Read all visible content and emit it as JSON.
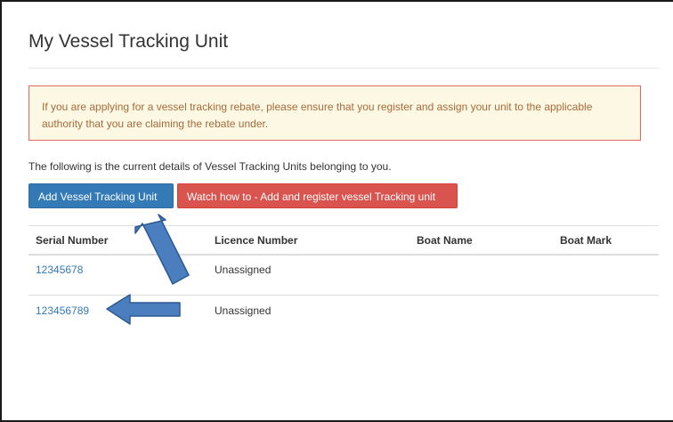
{
  "page": {
    "title": "My Vessel Tracking Unit"
  },
  "alert": {
    "text": "If you are applying for a vessel tracking rebate, please ensure that you register and assign your unit to the applicable authority that you are claiming the rebate under."
  },
  "intro_text": "The following is the current details of Vessel Tracking Units belonging to you.",
  "buttons": {
    "add_label": "Add Vessel Tracking Unit",
    "watch_label": "Watch how to - Add and register vessel Tracking unit"
  },
  "table": {
    "headers": [
      "Serial Number",
      "Licence Number",
      "Boat Name",
      "Boat Mark"
    ],
    "rows": [
      {
        "serial": "12345678",
        "licence": "Unassigned",
        "boat_name": "",
        "boat_mark": ""
      },
      {
        "serial": "123456789",
        "licence": "Unassigned",
        "boat_name": "",
        "boat_mark": ""
      }
    ]
  },
  "colors": {
    "primary": "#337ab7",
    "danger": "#d9534f",
    "alert_bg": "#fcf8e3",
    "alert_border": "#e06666",
    "annotation_arrow": "#4a7ebf"
  },
  "annotations": {
    "arrow_1_icon": "arrow-up-left-icon",
    "arrow_2_icon": "arrow-left-icon"
  }
}
